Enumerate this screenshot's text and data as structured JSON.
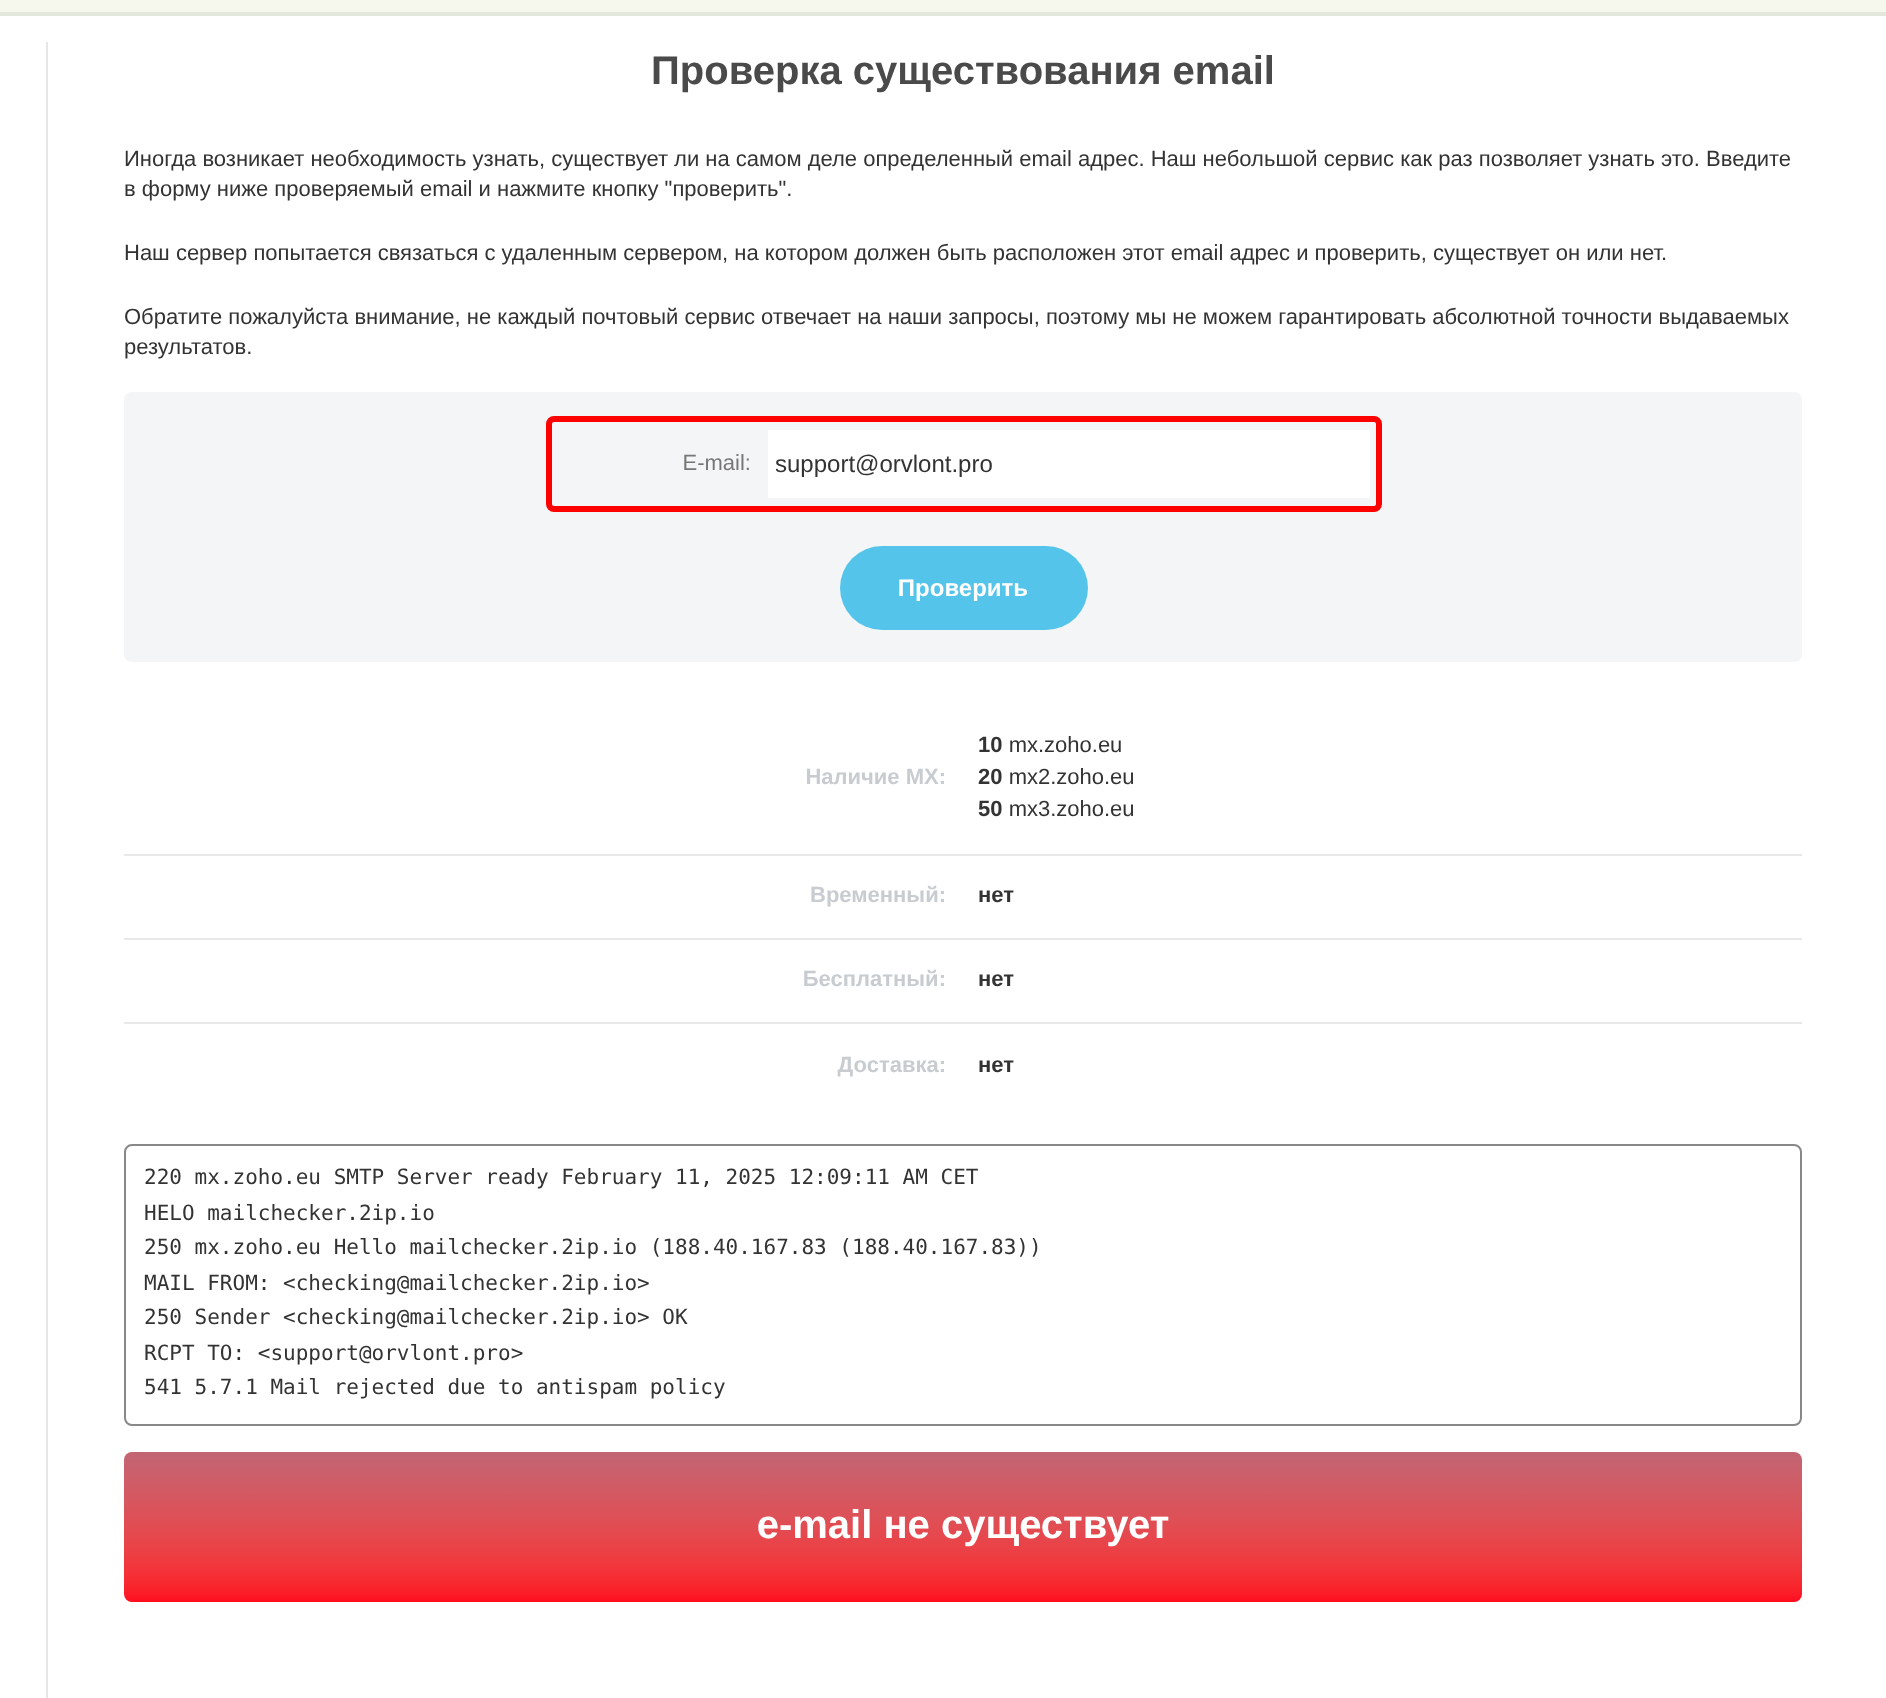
{
  "title": "Проверка существования email",
  "intro": [
    "Иногда возникает необходимость узнать, существует ли на самом деле определенный email адрес. Наш небольшой сервис как раз позволяет узнать это. Введите в форму ниже проверяемый email и нажмите кнопку \"проверить\".",
    "Наш сервер попытается связаться с удаленным сервером, на котором должен быть расположен этот email адрес и проверить, существует он или нет.",
    "Обратите пожалуйста внимание, не каждый почтовый сервис отвечает на наши запросы, поэтому мы не можем гарантировать абсолютной точности выдаваемых результатов."
  ],
  "form": {
    "label": "E-mail:",
    "value": "support@orvlont.pro",
    "highlighted": true,
    "button": "Проверить"
  },
  "results": [
    {
      "label": "Наличие MX:",
      "kind": "mx",
      "records": [
        {
          "priority": "10",
          "host": "mx.zoho.eu"
        },
        {
          "priority": "20",
          "host": "mx2.zoho.eu"
        },
        {
          "priority": "50",
          "host": "mx3.zoho.eu"
        }
      ]
    },
    {
      "label": "Временный:",
      "kind": "text",
      "value": "нет"
    },
    {
      "label": "Бесплатный:",
      "kind": "text",
      "value": "нет"
    },
    {
      "label": "Доставка:",
      "kind": "text",
      "value": "нет"
    }
  ],
  "log": [
    "220 mx.zoho.eu SMTP Server ready February 11, 2025 12:09:11 AM CET",
    "HELO mailchecker.2ip.io",
    "250 mx.zoho.eu Hello mailchecker.2ip.io (188.40.167.83 (188.40.167.83))",
    "MAIL FROM: <checking@mailchecker.2ip.io>",
    "250 Sender <checking@mailchecker.2ip.io> OK",
    "RCPT TO: <support@orvlont.pro>",
    "541 5.7.1 Mail rejected due to antispam policy"
  ],
  "verdict": {
    "text": "e-mail не существует",
    "exists": false
  }
}
